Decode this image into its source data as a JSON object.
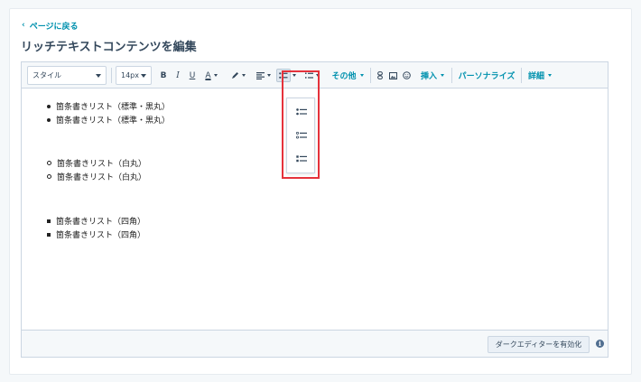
{
  "nav": {
    "back_label": "ページに戻る",
    "back_icon": "chevron-left-icon"
  },
  "page": {
    "title": "リッチテキストコンテンツを編集"
  },
  "toolbar": {
    "style_select": "スタイル",
    "size_select": "14px",
    "bold": "B",
    "italic": "I",
    "underline": "U",
    "font_color": "A",
    "more_label": "その他",
    "insert_label": "挿入",
    "personalize_label": "パーソナライズ",
    "details_label": "詳細"
  },
  "list_style_dropdown": {
    "options": [
      "list-style-disc",
      "list-style-circle",
      "list-style-square"
    ]
  },
  "content": {
    "items": [
      "箇条書きリスト（標準・黒丸）",
      "箇条書きリスト（標準・黒丸）",
      "箇条書きリスト（白丸）",
      "箇条書きリスト（白丸）",
      "箇条書きリスト（四角）",
      "箇条書きリスト（四角）"
    ]
  },
  "footer": {
    "dark_editor_button": "ダークエディターを有効化",
    "info_icon": "i"
  },
  "colors": {
    "accent": "#0091ae",
    "highlight": "#e5323b",
    "text": "#33475b"
  }
}
